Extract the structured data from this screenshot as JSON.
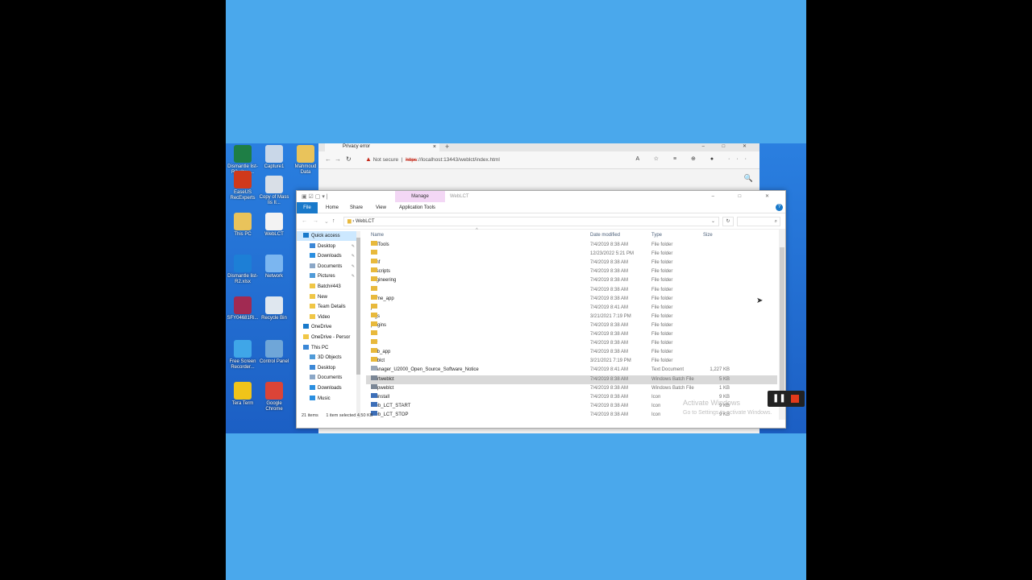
{
  "desktop": {
    "icons": [
      {
        "label": "Dismantle list-R2.xlsx_...",
        "color": "#1e7e45"
      },
      {
        "label": "Capture1",
        "color": "#c9d7e8"
      },
      {
        "label": "Mahmoud Data",
        "color": "#e9c35b"
      },
      {
        "label": "EaseUS RecExperts",
        "color": "#d0391b"
      },
      {
        "label": "Copy of Mass lis II...",
        "color": "#d9dfe7"
      },
      {
        "label": "This PC",
        "color": "#e9c35b"
      },
      {
        "label": "WebLCT",
        "color": "#f3f3f3"
      },
      {
        "label": "Dismantle list-R2.xlsx",
        "color": "#1d7fd6"
      },
      {
        "label": "Network",
        "color": "#7bb6f0"
      },
      {
        "label": "SFY04681Ri...",
        "color": "#a12a52"
      },
      {
        "label": "Recycle Bin",
        "color": "#dfe7ef"
      },
      {
        "label": "Free Screen Recorder...",
        "color": "#3fa6e8"
      },
      {
        "label": "Control Panel",
        "color": "#6fa6d8"
      },
      {
        "label": "Tera Term",
        "color": "#f0c419"
      },
      {
        "label": "Google Chrome",
        "color": "#db4437"
      }
    ]
  },
  "browser": {
    "tab_title": "Privacy error",
    "tab_close": "×",
    "new_tab": "+",
    "window_controls": "– □ ✕",
    "back": "←",
    "forward": "→",
    "reload": "↻",
    "security_label": "Not secure",
    "url_scheme": "https",
    "url_rest": "://localhost:13443/weblct/index.html",
    "toolbar_icons": "A ☆ ≡ ⊕ ●  ···",
    "search_icon": "🔍"
  },
  "explorer": {
    "window_title": "WebLCT",
    "contextual_tab": "Manage",
    "window_controls": "– □ ✕",
    "ribbon_tabs": [
      "File",
      "Home",
      "Share",
      "View",
      "Application Tools"
    ],
    "help_icon": "?",
    "path": "WebLCT",
    "columns": {
      "name": "Name",
      "date": "Date modified",
      "type": "Type",
      "size": "Size"
    },
    "sidebar": [
      {
        "label": "Quick access",
        "icon": "star",
        "color": "#1979ca",
        "indent": 0
      },
      {
        "label": "Desktop",
        "icon": "folder",
        "color": "#3b87d6",
        "indent": 1,
        "pin": true
      },
      {
        "label": "Downloads",
        "icon": "download",
        "color": "#2a8ee0",
        "indent": 1,
        "pin": true
      },
      {
        "label": "Documents",
        "icon": "doc",
        "color": "#8ba7c7",
        "indent": 1,
        "pin": true
      },
      {
        "label": "Pictures",
        "icon": "picture",
        "color": "#4f9ad8",
        "indent": 1,
        "pin": true
      },
      {
        "label": "Batch#443",
        "icon": "folder",
        "color": "#f0c646",
        "indent": 1
      },
      {
        "label": "New",
        "icon": "folder",
        "color": "#f0c646",
        "indent": 1
      },
      {
        "label": "Team Details",
        "icon": "folder",
        "color": "#f0c646",
        "indent": 1
      },
      {
        "label": "Video",
        "icon": "folder",
        "color": "#f0c646",
        "indent": 1
      },
      {
        "label": "OneDrive",
        "icon": "cloud",
        "color": "#1979ca",
        "indent": 0
      },
      {
        "label": "OneDrive - Persor",
        "icon": "folder",
        "color": "#f0c646",
        "indent": 0
      },
      {
        "label": "This PC",
        "icon": "pc",
        "color": "#3b87d6",
        "indent": 0
      },
      {
        "label": "3D Objects",
        "icon": "cube",
        "color": "#4f9ad8",
        "indent": 1
      },
      {
        "label": "Desktop",
        "icon": "folder",
        "color": "#3b87d6",
        "indent": 1
      },
      {
        "label": "Documents",
        "icon": "doc",
        "color": "#8ba7c7",
        "indent": 1
      },
      {
        "label": "Downloads",
        "icon": "download",
        "color": "#2a8ee0",
        "indent": 1
      },
      {
        "label": "Music",
        "icon": "music",
        "color": "#2a8ee0",
        "indent": 1
      }
    ],
    "files": [
      {
        "name": "3rdTools",
        "date": "7/4/2019 8:38 AM",
        "type": "File folder",
        "size": "",
        "kind": "folder"
      },
      {
        "name": "bin",
        "date": "12/23/2022 5:21 PM",
        "type": "File folder",
        "size": "",
        "kind": "folder"
      },
      {
        "name": "conf",
        "date": "7/4/2019 8:38 AM",
        "type": "File folder",
        "size": "",
        "kind": "folder"
      },
      {
        "name": "dbscripts",
        "date": "7/4/2019 8:38 AM",
        "type": "File folder",
        "size": "",
        "kind": "folder"
      },
      {
        "name": "engineering",
        "date": "7/4/2019 8:38 AM",
        "type": "File folder",
        "size": "",
        "kind": "folder"
      },
      {
        "name": "etc",
        "date": "7/4/2019 8:38 AM",
        "type": "File folder",
        "size": "",
        "kind": "folder"
      },
      {
        "name": "frame_app",
        "date": "7/4/2019 8:38 AM",
        "type": "File folder",
        "size": "",
        "kind": "folder"
      },
      {
        "name": "jre",
        "date": "7/4/2019 8:41 AM",
        "type": "File folder",
        "size": "",
        "kind": "folder"
      },
      {
        "name": "logs",
        "date": "3/21/2021 7:19 PM",
        "type": "File folder",
        "size": "",
        "kind": "folder"
      },
      {
        "name": "plugins",
        "date": "7/4/2019 8:38 AM",
        "type": "File folder",
        "size": "",
        "kind": "folder"
      },
      {
        "name": "res",
        "date": "7/4/2019 8:38 AM",
        "type": "File folder",
        "size": "",
        "kind": "folder"
      },
      {
        "name": "var",
        "date": "7/4/2019 8:38 AM",
        "type": "File folder",
        "size": "",
        "kind": "folder"
      },
      {
        "name": "web_app",
        "date": "7/4/2019 8:38 AM",
        "type": "File folder",
        "size": "",
        "kind": "folder"
      },
      {
        "name": "weblct",
        "date": "3/21/2021 7:19 PM",
        "type": "File folder",
        "size": "",
        "kind": "folder"
      },
      {
        "name": "iManager_U2000_Open_Source_Software_Notice",
        "date": "7/4/2019 8:41 AM",
        "type": "Text Document",
        "size": "1,227 KB",
        "kind": "text"
      },
      {
        "name": "startweblct",
        "date": "7/4/2019 8:38 AM",
        "type": "Windows Batch File",
        "size": "5 KB",
        "kind": "batch",
        "selected": true
      },
      {
        "name": "stopweblct",
        "date": "7/4/2019 8:38 AM",
        "type": "Windows Batch File",
        "size": "1 KB",
        "kind": "batch"
      },
      {
        "name": "Uninstall",
        "date": "7/4/2019 8:38 AM",
        "type": "Icon",
        "size": "9 KB",
        "kind": "icon"
      },
      {
        "name": "Web_LCT_START",
        "date": "7/4/2019 8:38 AM",
        "type": "Icon",
        "size": "9 KB",
        "kind": "icon"
      },
      {
        "name": "Web_LCT_STOP",
        "date": "7/4/2019 8:38 AM",
        "type": "Icon",
        "size": "9 KB",
        "kind": "icon"
      }
    ],
    "status": {
      "count": "21 items",
      "selection": "1 item selected  4.50 KB"
    }
  },
  "overlay": {
    "watermark_title": "Activate Windows",
    "watermark_sub": "Go to Settings to activate Windows."
  }
}
